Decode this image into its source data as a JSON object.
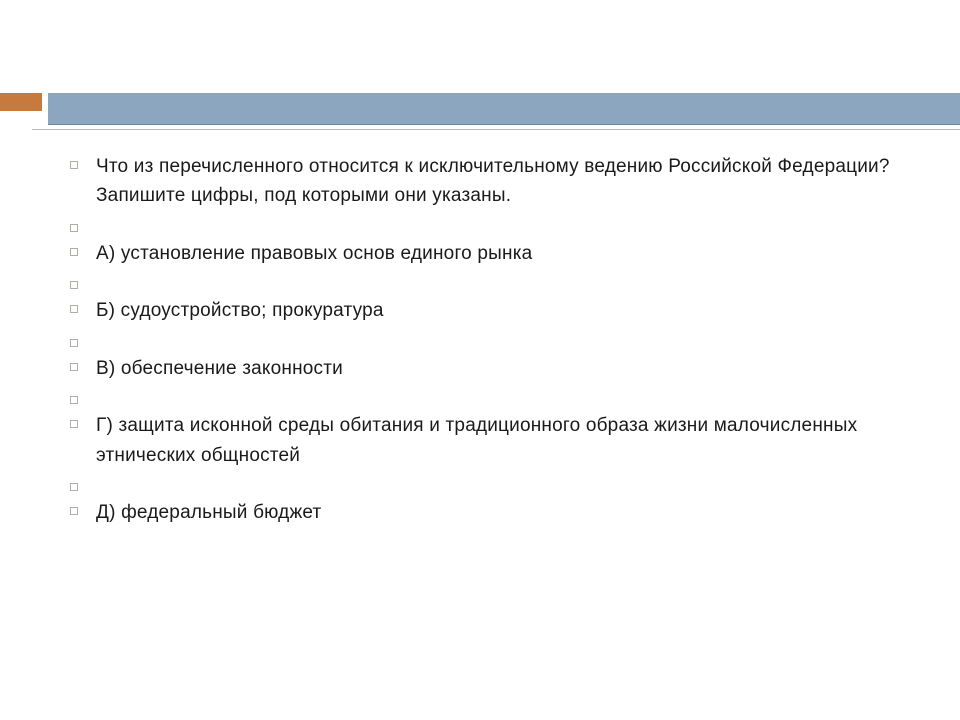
{
  "items": [
    {
      "text": "Что из перечисленного относится к исключительному ведению Российской Федерации? Запишите цифры, под которыми они указаны.",
      "spacer": false
    },
    {
      "text": "",
      "spacer": true
    },
    {
      "text": "А) установление правовых основ единого рынка",
      "spacer": false
    },
    {
      "text": "",
      "spacer": true
    },
    {
      "text": "Б) судоустройство; прокуратура",
      "spacer": false
    },
    {
      "text": "",
      "spacer": true
    },
    {
      "text": "В) обеспечение законности",
      "spacer": false
    },
    {
      "text": "",
      "spacer": true
    },
    {
      "text": "Г) защита исконной среды обитания и традиционного образа жизни малочисленных этнических общностей",
      "spacer": false
    },
    {
      "text": "",
      "spacer": true
    },
    {
      "text": "Д) федеральный бюджет",
      "spacer": false
    }
  ]
}
